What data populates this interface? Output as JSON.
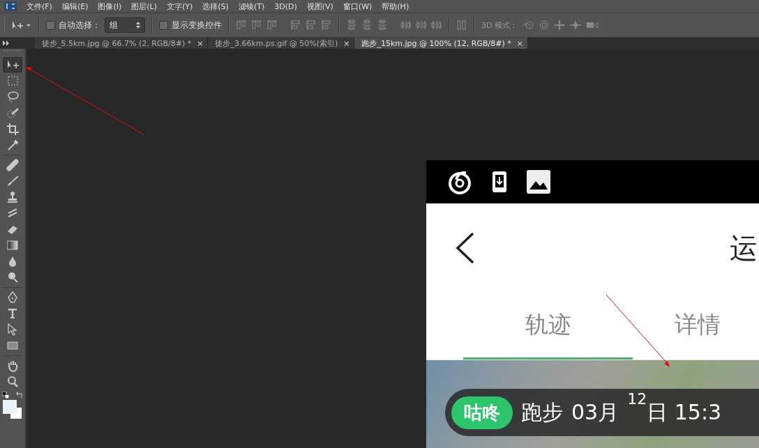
{
  "menu_bar": {
    "items": [
      "文件(F)",
      "编辑(E)",
      "图像(I)",
      "图层(L)",
      "文字(Y)",
      "选择(S)",
      "滤镜(T)",
      "3D(D)",
      "视图(V)",
      "窗口(W)",
      "帮助(H)"
    ]
  },
  "options_bar": {
    "auto_select": {
      "label": "自动选择：",
      "checked": false
    },
    "auto_select_dropdown": {
      "value": "组"
    },
    "show_transform": {
      "label": "显示变换控件",
      "checked": false
    },
    "mode_3d_label": "3D 模式："
  },
  "document_tabs": [
    {
      "title": "徒步_5.5km.jpg @ 66.7% (2, RGB/8#) *",
      "close": "×",
      "selected": false
    },
    {
      "title": "徒步_3.66km.ps.gif @ 50%(索引)",
      "close": "×",
      "selected": false
    },
    {
      "title": "跑步_15km.jpg @ 100% (12, RGB/8#) *",
      "close": "×",
      "selected": true
    }
  ],
  "toolbox": {
    "tools": [
      {
        "kind": "move",
        "selected": true
      },
      {
        "kind": "marquee",
        "selected": false
      },
      {
        "kind": "lasso",
        "selected": false
      },
      {
        "kind": "quickselect",
        "selected": false
      },
      {
        "kind": "crop",
        "selected": false
      },
      {
        "kind": "eyedropper",
        "selected": false
      },
      {
        "kind": "bandage",
        "selected": false
      },
      {
        "kind": "brush",
        "selected": false
      },
      {
        "kind": "stamp",
        "selected": false
      },
      {
        "kind": "historybrush",
        "selected": false
      },
      {
        "kind": "eraser",
        "selected": false
      },
      {
        "kind": "gradient",
        "selected": false
      },
      {
        "kind": "drop",
        "selected": false
      },
      {
        "kind": "dodge",
        "selected": false
      },
      {
        "kind": "pen",
        "selected": false
      },
      {
        "kind": "type",
        "selected": false
      },
      {
        "kind": "pointer",
        "selected": false
      },
      {
        "kind": "rectangle",
        "selected": false
      },
      {
        "kind": "hand",
        "selected": false
      },
      {
        "kind": "zoom",
        "selected": false
      }
    ]
  },
  "document": {
    "header": {
      "title": "运"
    },
    "tabs": [
      {
        "label": "轨迹",
        "selected": true
      },
      {
        "label": "详情",
        "selected": false
      }
    ],
    "map_overlay": {
      "badge": "咕咚",
      "activity": "跑步",
      "month": "03月",
      "raised_number": "12",
      "day_time": "日 15:3"
    }
  }
}
